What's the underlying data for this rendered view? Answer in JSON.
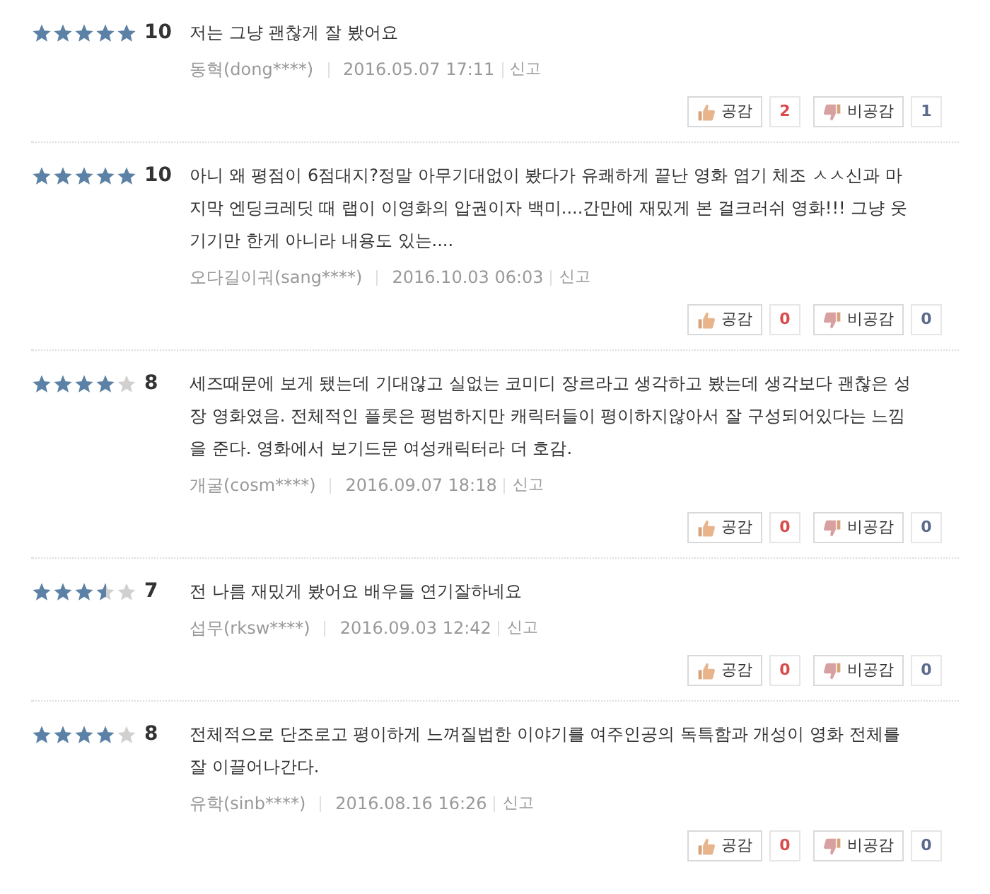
{
  "reviews": [
    {
      "stars": 5,
      "score": "10",
      "text": "저는 그냥 괜찮게 잘 봤어요",
      "author": "동혁(dong****)",
      "date": "2016.05.07 17:11",
      "report": "신고",
      "like_label": "공감",
      "like_count": "2",
      "dislike_label": "비공감",
      "dislike_count": "1"
    },
    {
      "stars": 5,
      "score": "10",
      "text": "아니 왜 평점이 6점대지?정말 아무기대없이 봤다가 유쾌하게 끝난 영화 엽기 체조 ㅅㅅ신과 마지막 엔딩크레딧 때 랩이 이영화의 압권이자 백미....간만에 재밌게 본 걸크러쉬 영화!!! 그냥 웃기기만 한게 아니라 내용도 있는....",
      "author": "오다길이궈(sang****)",
      "date": "2016.10.03 06:03",
      "report": "신고",
      "like_label": "공감",
      "like_count": "0",
      "dislike_label": "비공감",
      "dislike_count": "0"
    },
    {
      "stars": 4,
      "score": "8",
      "text": "세즈때문에 보게 됐는데 기대않고 실없는 코미디 장르라고 생각하고 봤는데 생각보다 괜찮은 성장 영화였음. 전체적인 플롯은 평범하지만 캐릭터들이 평이하지않아서 잘 구성되어있다는 느낌을 준다. 영화에서 보기드문 여성캐릭터라 더 호감.",
      "author": "개굴(cosm****)",
      "date": "2016.09.07 18:18",
      "report": "신고",
      "like_label": "공감",
      "like_count": "0",
      "dislike_label": "비공감",
      "dislike_count": "0"
    },
    {
      "stars": 3.5,
      "score": "7",
      "text": "전 나름 재밌게 봤어요 배우들 연기잘하네요",
      "author": "섭무(rksw****)",
      "date": "2016.09.03 12:42",
      "report": "신고",
      "like_label": "공감",
      "like_count": "0",
      "dislike_label": "비공감",
      "dislike_count": "0"
    },
    {
      "stars": 4,
      "score": "8",
      "text": "전체적으로 단조로고 평이하게 느껴질법한 이야기를 여주인공의 독특함과 개성이 영화 전체를 잘 이끌어나간다.",
      "author": "유학(sinb****)",
      "date": "2016.08.16 16:26",
      "report": "신고",
      "like_label": "공감",
      "like_count": "0",
      "dislike_label": "비공감",
      "dislike_count": "0"
    }
  ]
}
